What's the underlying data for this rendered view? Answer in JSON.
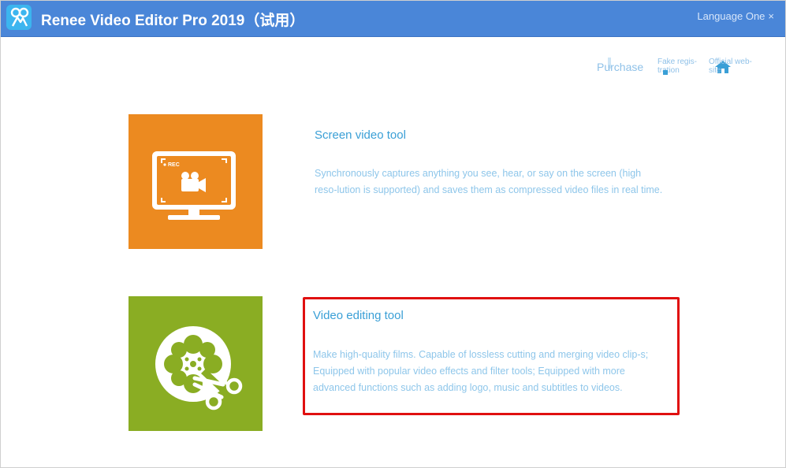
{
  "window": {
    "title": "Renee Video Editor Pro 2019（试用）",
    "language_button": "Language One",
    "language_close": "×"
  },
  "top_links": {
    "purchase": "Purchase",
    "fake_registration": "Fake regis-tration",
    "official_website": "Official web-site"
  },
  "tools": [
    {
      "title": "Screen video tool",
      "description": "Synchronously captures anything you see, hear, or say on the screen (high reso-lution is supported) and saves them as compressed video files in real time.",
      "tile_color": "#ec8a20",
      "icon": "screen-record-icon",
      "icon_text": "REC"
    },
    {
      "title": "Video editing tool",
      "description": "Make high-quality films. Capable of lossless cutting and merging video clip-s; Equipped with popular video effects and filter tools; Equipped with more advanced functions such as adding logo, music and subtitles to videos.",
      "tile_color": "#8aad23",
      "icon": "film-reel-scissors-icon",
      "highlighted": true
    }
  ],
  "colors": {
    "titlebar": "#4a86d8",
    "link": "#3a9fd6",
    "description": "#8ec6ea",
    "highlight": "#e01010"
  }
}
